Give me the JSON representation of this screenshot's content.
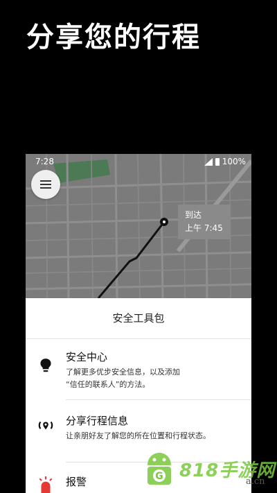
{
  "hero": {
    "title": "分享您的行程"
  },
  "status": {
    "time": "7:28",
    "battery": "100%"
  },
  "map": {
    "arrive_label": "到达",
    "arrive_time": "上午 7:45"
  },
  "sheet": {
    "title": "安全工具包",
    "items": [
      {
        "title": "安全中心",
        "desc_line1": "了解更多优步安全信息，以及添加",
        "desc_line2": "“信任的联系人”的方法。",
        "icon": "lightbulb-icon"
      },
      {
        "title": "分享行程信息",
        "desc_line1": "让亲朋好友了解您的所在位置和行程状态。",
        "icon": "location-broadcast-icon"
      },
      {
        "title": "报警",
        "icon": "alarm-icon"
      }
    ]
  },
  "watermark": {
    "text": "818手游网",
    "domain": "a.cn"
  },
  "colors": {
    "background": "#000000",
    "map": "#7b7b7b",
    "sheet": "#ffffff",
    "watermark": "#78c83c"
  }
}
